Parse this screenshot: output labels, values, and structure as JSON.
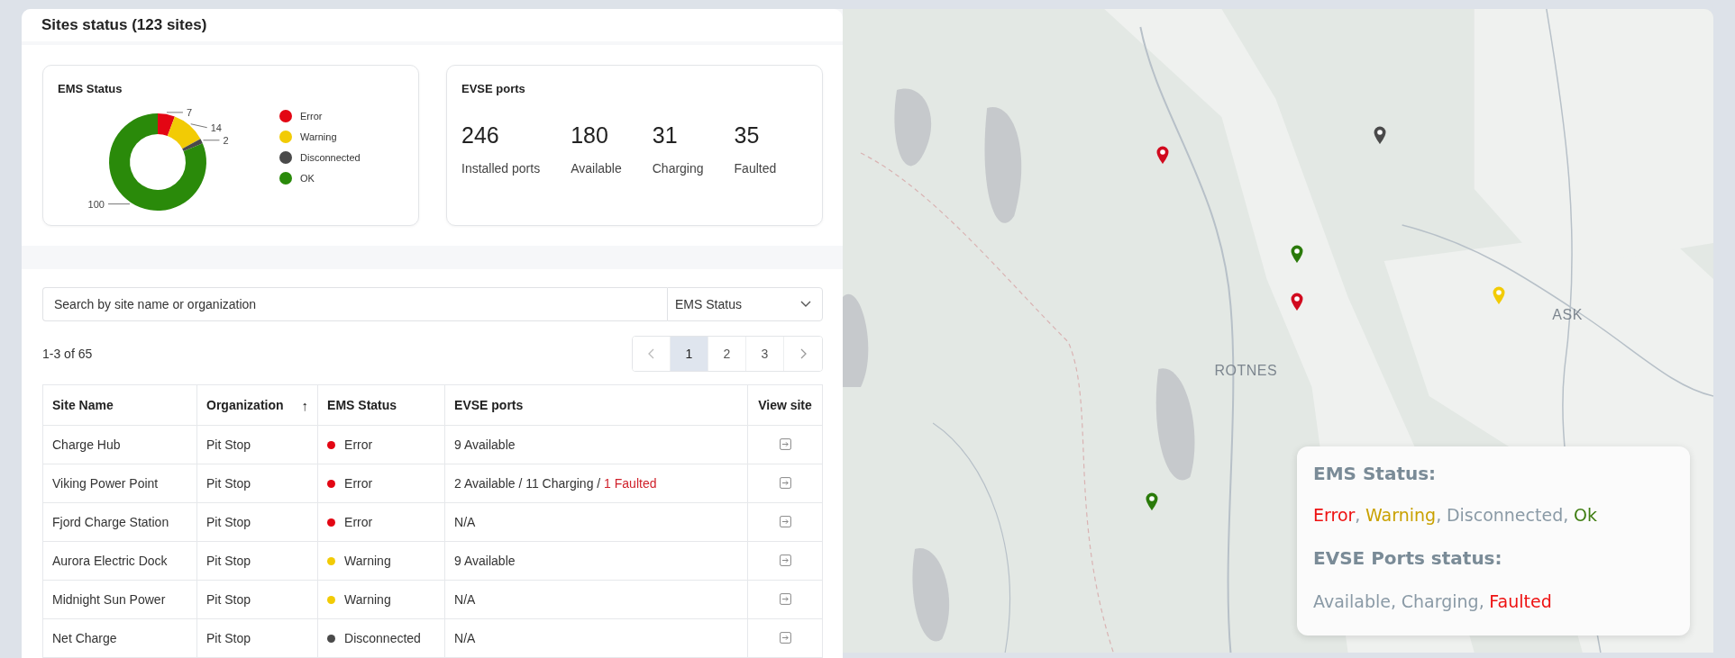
{
  "panel": {
    "title": "Sites status (123 sites)"
  },
  "ems_card": {
    "title": "EMS Status",
    "chart_data": {
      "type": "donut",
      "categories": [
        "Error",
        "Warning",
        "Disconnected",
        "OK"
      ],
      "values": [
        7,
        14,
        2,
        100
      ],
      "colors": [
        "#e30613",
        "#f2cb05",
        "#4a4a4a",
        "#2a8a0a"
      ],
      "data_labels": true
    }
  },
  "evse_card": {
    "title": "EVSE ports",
    "stats": [
      {
        "value": "246",
        "label": "Installed ports"
      },
      {
        "value": "180",
        "label": "Available"
      },
      {
        "value": "31",
        "label": "Charging"
      },
      {
        "value": "35",
        "label": "Faulted"
      }
    ]
  },
  "search": {
    "placeholder": "Search by site name or organization"
  },
  "status_filter": {
    "value": "EMS Status"
  },
  "range": "1-3 of 65",
  "pagination": [
    {
      "kind": "prev",
      "disabled": true,
      "selected": false
    },
    {
      "kind": "page",
      "label": "1",
      "selected": true
    },
    {
      "kind": "page",
      "label": "2",
      "selected": false
    },
    {
      "kind": "page",
      "label": "3",
      "selected": false
    },
    {
      "kind": "next",
      "disabled": false,
      "selected": false
    }
  ],
  "table": {
    "columns": [
      {
        "label": "Site Name"
      },
      {
        "label": "Organization",
        "sort": "↑"
      },
      {
        "label": "EMS Status"
      },
      {
        "label": "EVSE ports"
      },
      {
        "label": "View site"
      }
    ],
    "rows": [
      {
        "site": "Charge Hub",
        "organization": "Pit Stop",
        "status": "Error",
        "color": "#e30613",
        "ports": "9 Available"
      },
      {
        "site": "Viking Power Point",
        "organization": "Pit Stop",
        "status": "Error",
        "color": "#e30613",
        "ports": "2 Available / 11 Charging / ",
        "ports_alert": "1 Faulted"
      },
      {
        "site": "Fjord Charge Station",
        "organization": "Pit Stop",
        "status": "Error",
        "color": "#e30613",
        "ports": "N/A"
      },
      {
        "site": "Aurora Electric Dock",
        "organization": "Pit Stop",
        "status": "Warning",
        "color": "#f2cb05",
        "ports": "9 Available"
      },
      {
        "site": "Midnight Sun Power",
        "organization": "Pit Stop",
        "status": "Warning",
        "color": "#f2cb05",
        "ports": "N/A"
      },
      {
        "site": "Net Charge",
        "organization": "Pit Stop",
        "status": "Disconnected",
        "color": "#4a4a4a",
        "ports": "N/A"
      }
    ]
  },
  "map": {
    "labels": [
      "ROTNES",
      "ASK"
    ],
    "pins": [
      {
        "color": "#d10a1e"
      },
      {
        "color": "#4a4a4a"
      },
      {
        "color": "#2a7a0a"
      },
      {
        "color": "#d10a1e"
      },
      {
        "color": "#f2cb05"
      },
      {
        "color": "#2a7a0a"
      }
    ],
    "legend": {
      "separator": ",",
      "ems_title": "EMS Status:",
      "ems_items": [
        {
          "label": "Error",
          "color": "#ee1111"
        },
        {
          "label": "Warning",
          "color": "#c9a100"
        },
        {
          "label": "Disconnected",
          "color": "#8a9aa6"
        },
        {
          "label": "Ok",
          "color": "#3f7d12"
        }
      ],
      "ports_title": "EVSE Ports status:",
      "ports_items": [
        {
          "label": "Available",
          "color": "#8a9aa6"
        },
        {
          "label": "Charging",
          "color": "#8a9aa6"
        },
        {
          "label": "Faulted",
          "color": "#ee1111"
        }
      ]
    }
  }
}
